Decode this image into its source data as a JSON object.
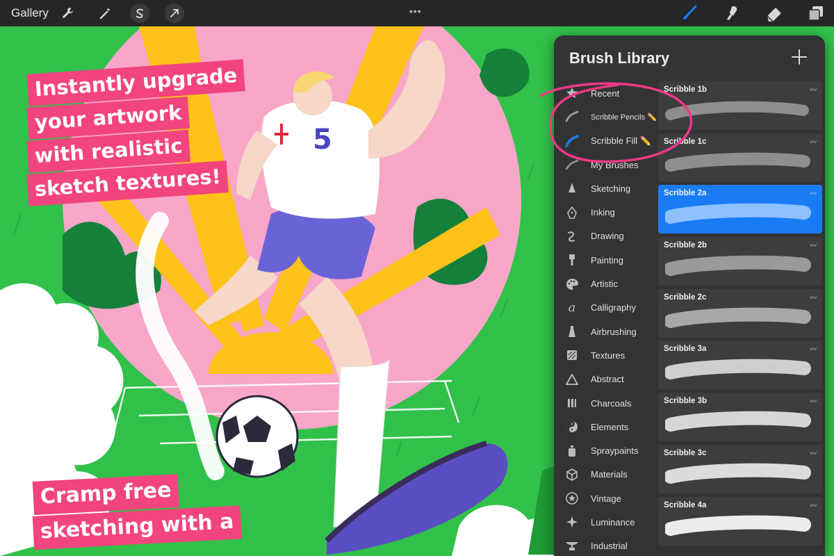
{
  "toolbar": {
    "gallery_label": "Gallery",
    "left_tools": [
      "wrench-icon",
      "magic-wand-icon",
      "selection-s-icon",
      "arrow-icon"
    ],
    "right_tools": [
      "brush-icon",
      "smudge-icon",
      "eraser-icon",
      "layers-icon"
    ],
    "active_tool": "brush-icon",
    "accent": "#1a7cf5"
  },
  "artwork": {
    "promo_top": [
      "Instantly upgrade",
      "your artwork",
      "with realistic",
      "sketch textures!"
    ],
    "promo_bottom": [
      "Cramp free",
      "sketching with a"
    ],
    "jersey_number": "5",
    "promo_color": "#f2447f"
  },
  "brush_library": {
    "title": "Brush Library",
    "categories": [
      {
        "label": "Recent",
        "icon": "star-icon"
      },
      {
        "label": "Scribble Pencils ✏️",
        "icon": "pencil-stroke-icon"
      },
      {
        "label": "Scribble Fill ✏️",
        "icon": "blue-stroke-icon"
      },
      {
        "label": "My Brushes",
        "icon": "stroke-icon"
      },
      {
        "label": "Sketching",
        "icon": "pencil-tip-icon"
      },
      {
        "label": "Inking",
        "icon": "pen-nib-icon"
      },
      {
        "label": "Drawing",
        "icon": "squiggle-icon"
      },
      {
        "label": "Painting",
        "icon": "paint-brush-icon"
      },
      {
        "label": "Artistic",
        "icon": "palette-icon"
      },
      {
        "label": "Calligraphy",
        "icon": "calligraphy-icon"
      },
      {
        "label": "Airbrushing",
        "icon": "airbrush-icon"
      },
      {
        "label": "Textures",
        "icon": "texture-icon"
      },
      {
        "label": "Abstract",
        "icon": "triangle-icon"
      },
      {
        "label": "Charcoals",
        "icon": "charcoal-icon"
      },
      {
        "label": "Elements",
        "icon": "yin-yang-icon"
      },
      {
        "label": "Spraypaints",
        "icon": "spray-can-icon"
      },
      {
        "label": "Materials",
        "icon": "cube-icon"
      },
      {
        "label": "Vintage",
        "icon": "vintage-star-icon"
      },
      {
        "label": "Luminance",
        "icon": "sparkle-icon"
      },
      {
        "label": "Industrial",
        "icon": "anvil-icon"
      }
    ],
    "selected_category": "Scribble Fill ✏️",
    "brushes": [
      {
        "name": "Scribble 1b"
      },
      {
        "name": "Scribble 1c"
      },
      {
        "name": "Scribble 2a"
      },
      {
        "name": "Scribble 2b"
      },
      {
        "name": "Scribble 2c"
      },
      {
        "name": "Scribble 3a"
      },
      {
        "name": "Scribble 3b"
      },
      {
        "name": "Scribble 3c"
      },
      {
        "name": "Scribble 4a"
      }
    ],
    "selected_brush": "Scribble 2a"
  }
}
